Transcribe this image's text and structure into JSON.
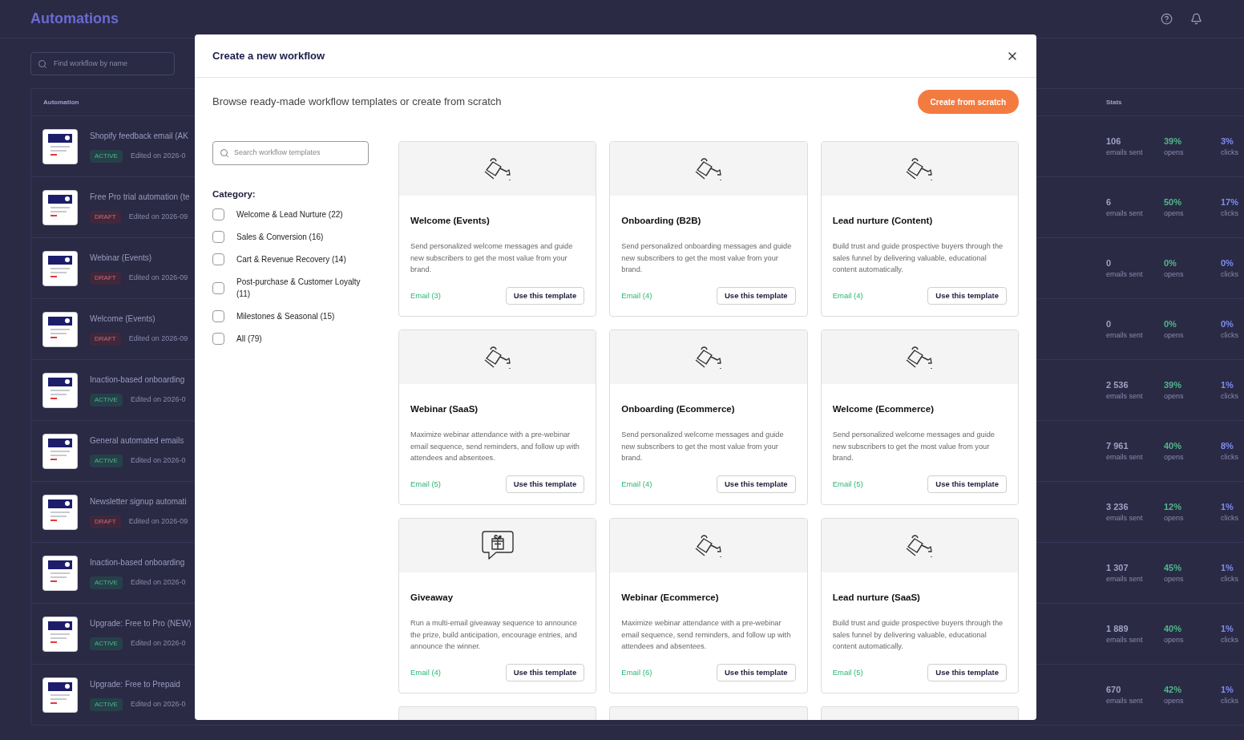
{
  "page": {
    "title": "Automations",
    "search": {
      "placeholder": "Find workflow by name"
    },
    "columns": [
      "Automation",
      "Stats"
    ],
    "rows": [
      {
        "name": "Shopify feedback email (AK",
        "status": "ACTIVE",
        "kind": "active",
        "edited": "Edited on 2026-0",
        "sent": "106",
        "sent_label": "emails sent",
        "opens": "39%",
        "opens_label": "opens",
        "clicks": "3%",
        "clicks_label": "clicks"
      },
      {
        "name": "Free Pro trial automation (te",
        "status": "DRAFT",
        "kind": "draft",
        "edited": "Edited on 2026-09",
        "sent": "6",
        "sent_label": "emails sent",
        "opens": "50%",
        "opens_label": "opens",
        "clicks": "17%",
        "clicks_label": "clicks"
      },
      {
        "name": "Webinar (Events)",
        "status": "DRAFT",
        "kind": "draft",
        "edited": "Edited on 2026-09",
        "sent": "0",
        "sent_label": "emails sent",
        "opens": "0%",
        "opens_label": "opens",
        "clicks": "0%",
        "clicks_label": "clicks"
      },
      {
        "name": "Welcome (Events)",
        "status": "DRAFT",
        "kind": "draft",
        "edited": "Edited on 2026-09",
        "sent": "0",
        "sent_label": "emails sent",
        "opens": "0%",
        "opens_label": "opens",
        "clicks": "0%",
        "clicks_label": "clicks"
      },
      {
        "name": "Inaction-based onboarding",
        "status": "ACTIVE",
        "kind": "active",
        "edited": "Edited on 2026-0",
        "sent": "2 536",
        "sent_label": "emails sent",
        "opens": "39%",
        "opens_label": "opens",
        "clicks": "1%",
        "clicks_label": "clicks"
      },
      {
        "name": "General automated emails",
        "status": "ACTIVE",
        "kind": "active",
        "edited": "Edited on 2026-0",
        "sent": "7 961",
        "sent_label": "emails sent",
        "opens": "40%",
        "opens_label": "opens",
        "clicks": "8%",
        "clicks_label": "clicks"
      },
      {
        "name": "Newsletter signup automati",
        "status": "DRAFT",
        "kind": "draft",
        "edited": "Edited on 2026-09",
        "sent": "3 236",
        "sent_label": "emails sent",
        "opens": "12%",
        "opens_label": "opens",
        "clicks": "1%",
        "clicks_label": "clicks"
      },
      {
        "name": "Inaction-based onboarding",
        "status": "ACTIVE",
        "kind": "active",
        "edited": "Edited on 2026-0",
        "sent": "1 307",
        "sent_label": "emails sent",
        "opens": "45%",
        "opens_label": "opens",
        "clicks": "1%",
        "clicks_label": "clicks"
      },
      {
        "name": "Upgrade: Free to Pro (NEW)",
        "status": "ACTIVE",
        "kind": "active",
        "edited": "Edited on 2026-0",
        "sent": "1 889",
        "sent_label": "emails sent",
        "opens": "40%",
        "opens_label": "opens",
        "clicks": "1%",
        "clicks_label": "clicks"
      },
      {
        "name": "Upgrade: Free to Prepaid",
        "status": "ACTIVE",
        "kind": "active",
        "edited": "Edited on 2026-0",
        "sent": "670",
        "sent_label": "emails sent",
        "opens": "42%",
        "opens_label": "opens",
        "clicks": "1%",
        "clicks_label": "clicks"
      }
    ]
  },
  "dialog": {
    "title": "Create a new workflow",
    "subtitle": "Browse ready-made workflow templates or create from scratch",
    "primary_button": "Create from scratch",
    "search": {
      "placeholder": "Search workflow templates"
    },
    "category_heading": "Category:",
    "categories": [
      {
        "label": "Welcome & Lead Nurture (22)",
        "checked": false
      },
      {
        "label": "Sales & Conversion (16)",
        "checked": false
      },
      {
        "label": "Cart & Revenue Recovery (14)",
        "checked": false
      },
      {
        "label": "Post-purchase & Customer Loyalty (11)",
        "checked": false
      },
      {
        "label": "Milestones & Seasonal (15)",
        "checked": false
      },
      {
        "label": "All (79)",
        "checked": false
      }
    ],
    "templates": [
      {
        "kind": "watering-can",
        "title": "Welcome (Events)",
        "description": "Send personalized welcome messages and guide new subscribers to get the most value from your brand.",
        "count": "Email (3)",
        "button": "Use this template"
      },
      {
        "kind": "watering-can",
        "title": "Onboarding (B2B)",
        "description": "Send personalized onboarding messages and guide new subscribers to get the most value from your brand.",
        "count": "Email (4)",
        "button": "Use this template"
      },
      {
        "kind": "watering-can",
        "title": "Lead nurture (Content)",
        "description": "Build trust and guide prospective buyers through the sales funnel by delivering valuable, educational content automatically.",
        "count": "Email (4)",
        "button": "Use this template"
      },
      {
        "kind": "watering-can",
        "title": "Webinar (SaaS)",
        "description": "Maximize webinar attendance with a pre-webinar email sequence, send reminders, and follow up with attendees and absentees.",
        "count": "Email (5)",
        "button": "Use this template"
      },
      {
        "kind": "watering-can",
        "title": "Onboarding (Ecommerce)",
        "description": "Send personalized welcome messages and guide new subscribers to get the most value from your brand.",
        "count": "Email (4)",
        "button": "Use this template"
      },
      {
        "kind": "watering-can",
        "title": "Welcome (Ecommerce)",
        "description": "Send personalized welcome messages and guide new subscribers to get the most value from your brand.",
        "count": "Email (5)",
        "button": "Use this template"
      },
      {
        "kind": "gift",
        "title": "Giveaway",
        "description": "Run a multi-email giveaway sequence to announce the prize, build anticipation, encourage entries, and announce the winner.",
        "count": "Email (4)",
        "button": "Use this template"
      },
      {
        "kind": "watering-can",
        "title": "Webinar (Ecommerce)",
        "description": "Maximize webinar attendance with a pre-webinar email sequence, send reminders, and follow up with attendees and absentees.",
        "count": "Email (6)",
        "button": "Use this template"
      },
      {
        "kind": "watering-can",
        "title": "Lead nurture (SaaS)",
        "description": "Build trust and guide prospective buyers through the sales funnel by delivering valuable, educational content automatically.",
        "count": "Email (5)",
        "button": "Use this template"
      },
      {
        "kind": "cut"
      },
      {
        "kind": "cut"
      },
      {
        "kind": "cut"
      }
    ]
  }
}
